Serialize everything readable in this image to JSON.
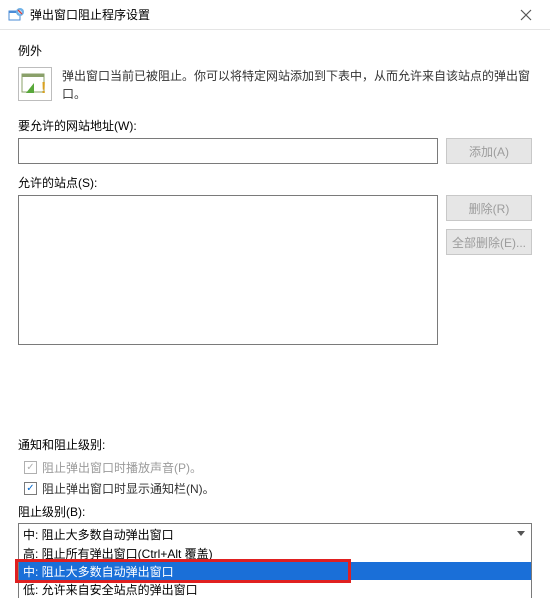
{
  "window": {
    "title": "弹出窗口阻止程序设置"
  },
  "exceptions": {
    "heading": "例外",
    "info": "弹出窗口当前已被阻止。你可以将特定网站添加到下表中，从而允许来自该站点的弹出窗口。",
    "address_label": "要允许的网站地址(W):",
    "address_value": "",
    "add_button": "添加(A)",
    "allowed_label": "允许的站点(S):",
    "remove_button": "删除(R)",
    "remove_all_button": "全部删除(E)..."
  },
  "notifications": {
    "heading": "通知和阻止级别:",
    "play_sound_label": "阻止弹出窗口时播放声音(P)。",
    "play_sound_checked": true,
    "show_bar_label": "阻止弹出窗口时显示通知栏(N)。",
    "show_bar_checked": true,
    "block_level_label": "阻止级别(B):",
    "combo_value": "中: 阻止大多数自动弹出窗口",
    "options": [
      "高: 阻止所有弹出窗口(Ctrl+Alt 覆盖)",
      "中: 阻止大多数自动弹出窗口",
      "低: 允许来自安全站点的弹出窗口"
    ]
  }
}
